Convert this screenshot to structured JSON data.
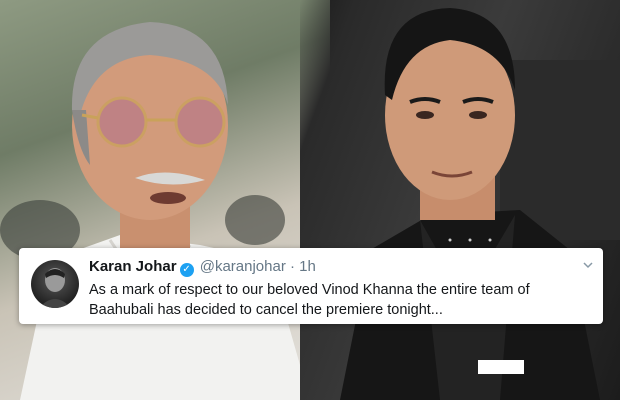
{
  "tweet": {
    "author_name": "Karan Johar",
    "handle": "@karanjohar",
    "separator": "·",
    "time": "1h",
    "text": "As a mark of respect to our beloved Vinod Khanna the entire team of Baahubali has decided to cancel the premiere tonight...",
    "verified_icon": "✓",
    "accent_color": "#1da1f2"
  }
}
